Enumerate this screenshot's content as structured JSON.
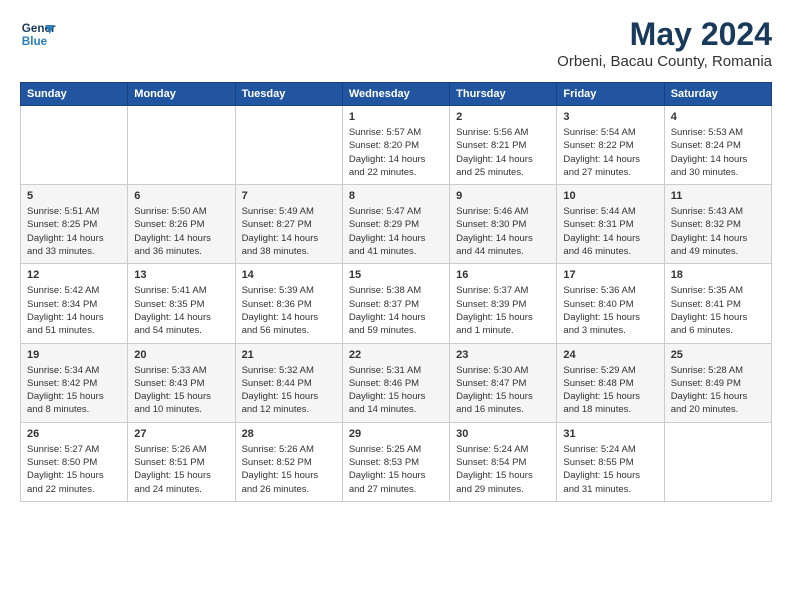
{
  "header": {
    "logo_line1": "General",
    "logo_line2": "Blue",
    "title": "May 2024",
    "subtitle": "Orbeni, Bacau County, Romania"
  },
  "days_of_week": [
    "Sunday",
    "Monday",
    "Tuesday",
    "Wednesday",
    "Thursday",
    "Friday",
    "Saturday"
  ],
  "weeks": [
    [
      {
        "num": "",
        "info": ""
      },
      {
        "num": "",
        "info": ""
      },
      {
        "num": "",
        "info": ""
      },
      {
        "num": "1",
        "info": "Sunrise: 5:57 AM\nSunset: 8:20 PM\nDaylight: 14 hours\nand 22 minutes."
      },
      {
        "num": "2",
        "info": "Sunrise: 5:56 AM\nSunset: 8:21 PM\nDaylight: 14 hours\nand 25 minutes."
      },
      {
        "num": "3",
        "info": "Sunrise: 5:54 AM\nSunset: 8:22 PM\nDaylight: 14 hours\nand 27 minutes."
      },
      {
        "num": "4",
        "info": "Sunrise: 5:53 AM\nSunset: 8:24 PM\nDaylight: 14 hours\nand 30 minutes."
      }
    ],
    [
      {
        "num": "5",
        "info": "Sunrise: 5:51 AM\nSunset: 8:25 PM\nDaylight: 14 hours\nand 33 minutes."
      },
      {
        "num": "6",
        "info": "Sunrise: 5:50 AM\nSunset: 8:26 PM\nDaylight: 14 hours\nand 36 minutes."
      },
      {
        "num": "7",
        "info": "Sunrise: 5:49 AM\nSunset: 8:27 PM\nDaylight: 14 hours\nand 38 minutes."
      },
      {
        "num": "8",
        "info": "Sunrise: 5:47 AM\nSunset: 8:29 PM\nDaylight: 14 hours\nand 41 minutes."
      },
      {
        "num": "9",
        "info": "Sunrise: 5:46 AM\nSunset: 8:30 PM\nDaylight: 14 hours\nand 44 minutes."
      },
      {
        "num": "10",
        "info": "Sunrise: 5:44 AM\nSunset: 8:31 PM\nDaylight: 14 hours\nand 46 minutes."
      },
      {
        "num": "11",
        "info": "Sunrise: 5:43 AM\nSunset: 8:32 PM\nDaylight: 14 hours\nand 49 minutes."
      }
    ],
    [
      {
        "num": "12",
        "info": "Sunrise: 5:42 AM\nSunset: 8:34 PM\nDaylight: 14 hours\nand 51 minutes."
      },
      {
        "num": "13",
        "info": "Sunrise: 5:41 AM\nSunset: 8:35 PM\nDaylight: 14 hours\nand 54 minutes."
      },
      {
        "num": "14",
        "info": "Sunrise: 5:39 AM\nSunset: 8:36 PM\nDaylight: 14 hours\nand 56 minutes."
      },
      {
        "num": "15",
        "info": "Sunrise: 5:38 AM\nSunset: 8:37 PM\nDaylight: 14 hours\nand 59 minutes."
      },
      {
        "num": "16",
        "info": "Sunrise: 5:37 AM\nSunset: 8:39 PM\nDaylight: 15 hours\nand 1 minute."
      },
      {
        "num": "17",
        "info": "Sunrise: 5:36 AM\nSunset: 8:40 PM\nDaylight: 15 hours\nand 3 minutes."
      },
      {
        "num": "18",
        "info": "Sunrise: 5:35 AM\nSunset: 8:41 PM\nDaylight: 15 hours\nand 6 minutes."
      }
    ],
    [
      {
        "num": "19",
        "info": "Sunrise: 5:34 AM\nSunset: 8:42 PM\nDaylight: 15 hours\nand 8 minutes."
      },
      {
        "num": "20",
        "info": "Sunrise: 5:33 AM\nSunset: 8:43 PM\nDaylight: 15 hours\nand 10 minutes."
      },
      {
        "num": "21",
        "info": "Sunrise: 5:32 AM\nSunset: 8:44 PM\nDaylight: 15 hours\nand 12 minutes."
      },
      {
        "num": "22",
        "info": "Sunrise: 5:31 AM\nSunset: 8:46 PM\nDaylight: 15 hours\nand 14 minutes."
      },
      {
        "num": "23",
        "info": "Sunrise: 5:30 AM\nSunset: 8:47 PM\nDaylight: 15 hours\nand 16 minutes."
      },
      {
        "num": "24",
        "info": "Sunrise: 5:29 AM\nSunset: 8:48 PM\nDaylight: 15 hours\nand 18 minutes."
      },
      {
        "num": "25",
        "info": "Sunrise: 5:28 AM\nSunset: 8:49 PM\nDaylight: 15 hours\nand 20 minutes."
      }
    ],
    [
      {
        "num": "26",
        "info": "Sunrise: 5:27 AM\nSunset: 8:50 PM\nDaylight: 15 hours\nand 22 minutes."
      },
      {
        "num": "27",
        "info": "Sunrise: 5:26 AM\nSunset: 8:51 PM\nDaylight: 15 hours\nand 24 minutes."
      },
      {
        "num": "28",
        "info": "Sunrise: 5:26 AM\nSunset: 8:52 PM\nDaylight: 15 hours\nand 26 minutes."
      },
      {
        "num": "29",
        "info": "Sunrise: 5:25 AM\nSunset: 8:53 PM\nDaylight: 15 hours\nand 27 minutes."
      },
      {
        "num": "30",
        "info": "Sunrise: 5:24 AM\nSunset: 8:54 PM\nDaylight: 15 hours\nand 29 minutes."
      },
      {
        "num": "31",
        "info": "Sunrise: 5:24 AM\nSunset: 8:55 PM\nDaylight: 15 hours\nand 31 minutes."
      },
      {
        "num": "",
        "info": ""
      }
    ]
  ]
}
